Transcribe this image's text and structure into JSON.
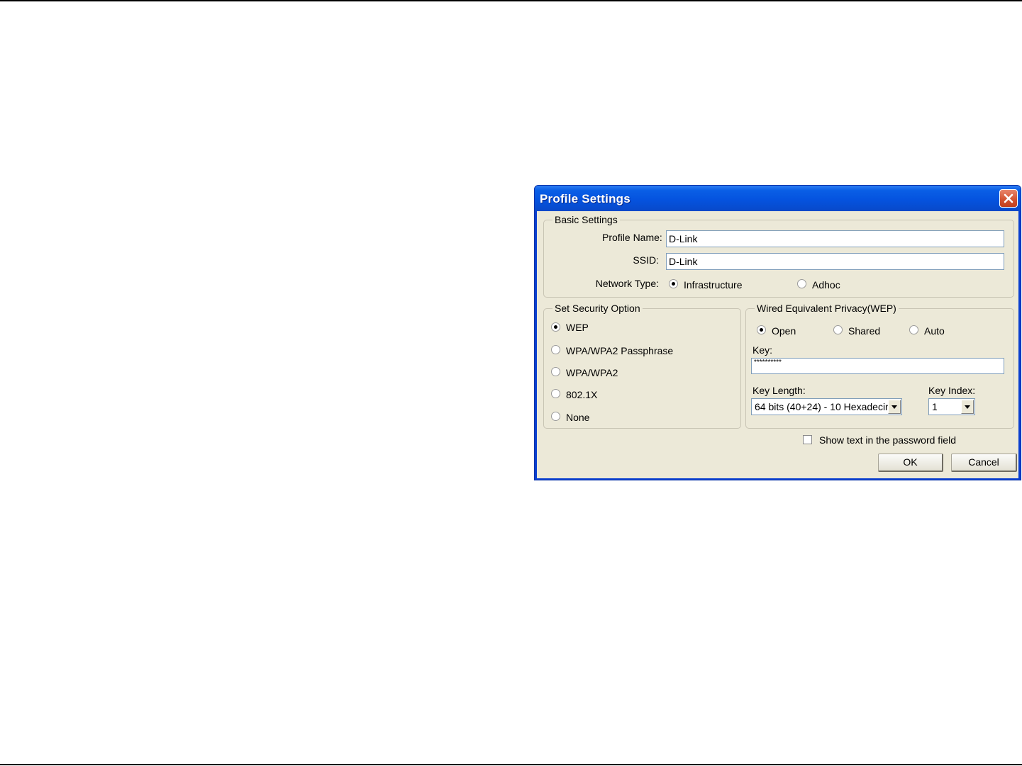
{
  "dialog": {
    "title": "Profile Settings",
    "basic_settings": {
      "legend": "Basic Settings",
      "profile_name_label": "Profile Name:",
      "profile_name_value": "D-Link",
      "ssid_label": "SSID:",
      "ssid_value": "D-Link",
      "network_type_label": "Network Type:",
      "network_types": [
        {
          "label": "Infrastructure",
          "selected": true
        },
        {
          "label": "Adhoc",
          "selected": false
        }
      ]
    },
    "security_option": {
      "legend": "Set Security Option",
      "options": [
        {
          "label": "WEP",
          "selected": true
        },
        {
          "label": "WPA/WPA2 Passphrase",
          "selected": false
        },
        {
          "label": "WPA/WPA2",
          "selected": false
        },
        {
          "label": "802.1X",
          "selected": false
        },
        {
          "label": "None",
          "selected": false
        }
      ]
    },
    "wep": {
      "legend": "Wired Equivalent Privacy(WEP)",
      "auth_modes": [
        {
          "label": "Open",
          "selected": true
        },
        {
          "label": "Shared",
          "selected": false
        },
        {
          "label": "Auto",
          "selected": false
        }
      ],
      "key_label": "Key:",
      "key_value": "**********",
      "key_length_label": "Key Length:",
      "key_length_value": "64 bits (40+24) - 10 Hexadecin",
      "key_index_label": "Key Index:",
      "key_index_value": "1"
    },
    "show_text_label": "Show text in the password field",
    "show_text_checked": false,
    "ok_label": "OK",
    "cancel_label": "Cancel"
  }
}
